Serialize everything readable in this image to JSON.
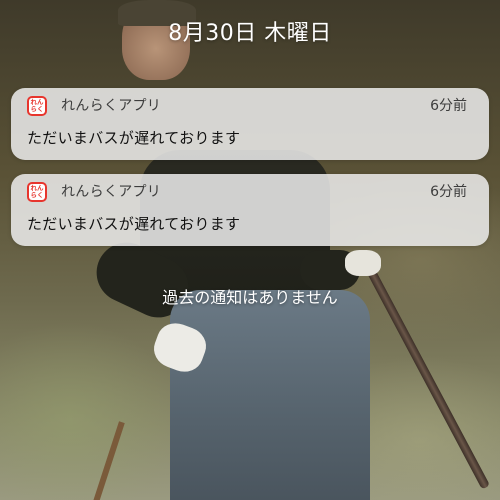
{
  "lock_screen": {
    "date": "8月30日 木曜日"
  },
  "notifications": [
    {
      "app_name": "れんらくアプリ",
      "app_icon_text_top": "れん",
      "app_icon_text_bottom": "らく",
      "time": "6分前",
      "message": "ただいまバスが遅れております"
    },
    {
      "app_name": "れんらくアプリ",
      "app_icon_text_top": "れん",
      "app_icon_text_bottom": "らく",
      "time": "6分前",
      "message": "ただいまバスが遅れております"
    }
  ],
  "footer": {
    "no_older_notifications": "過去の通知はありません"
  },
  "colors": {
    "app_icon_red": "#e7352d",
    "card_background": "rgba(236,236,236,0.86)"
  },
  "icons": {
    "app_icon": "renraku-app-icon"
  }
}
